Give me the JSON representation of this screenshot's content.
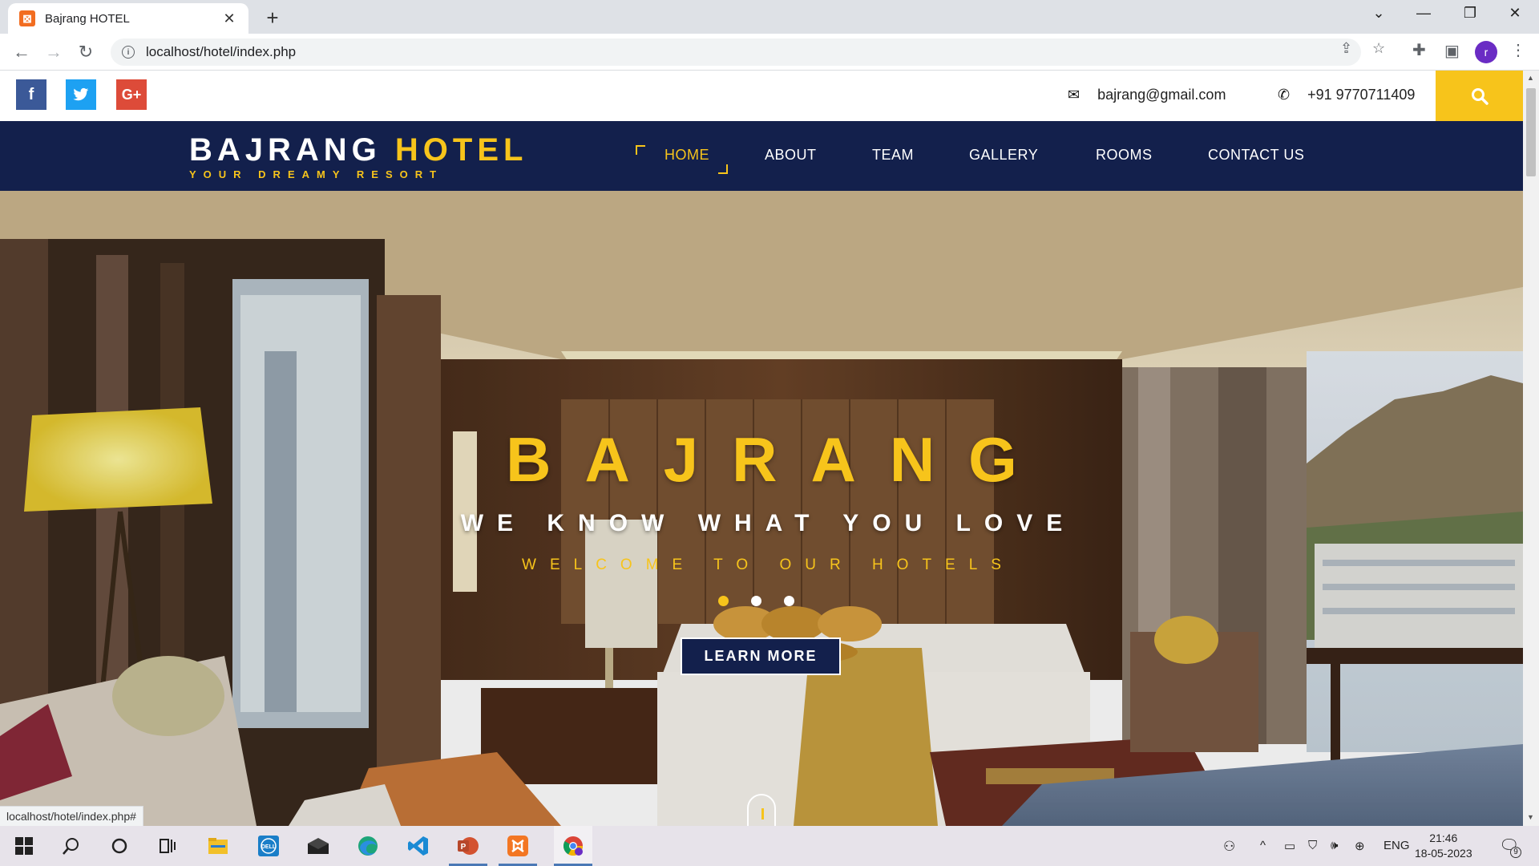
{
  "browser": {
    "tab_title": "Bajrang HOTEL",
    "tab_favicon": "xampp-icon",
    "url": "localhost/hotel/index.php",
    "profile_initial": "r",
    "new_tab_glyph": "+",
    "close_glyph": "✕",
    "back_glyph": "←",
    "forward_glyph": "→",
    "reload_glyph": "↻"
  },
  "topbar": {
    "social": [
      {
        "name": "facebook",
        "glyph": "f",
        "color": "#3b5998"
      },
      {
        "name": "twitter",
        "glyph": "t",
        "color": "#1da1f2"
      },
      {
        "name": "google-plus",
        "glyph": "G+",
        "color": "#dd4b39"
      }
    ],
    "email": "bajrang@gmail.com",
    "phone": "+91 9770711409",
    "search_color": "#f7c41b"
  },
  "navbar": {
    "brand_part1": "BAJRANG",
    "brand_part2": "HOTEL",
    "tagline": "YOUR DREAMY RESORT",
    "menu": [
      {
        "label": "HOME",
        "active": true
      },
      {
        "label": "ABOUT",
        "active": false
      },
      {
        "label": "TEAM",
        "active": false
      },
      {
        "label": "GALLERY",
        "active": false
      },
      {
        "label": "ROOMS",
        "active": false
      },
      {
        "label": "CONTACT US",
        "active": false
      }
    ],
    "bg_color": "#13204c",
    "accent_color": "#f7c41b"
  },
  "hero": {
    "title": "BAJRANG",
    "subtitle": "WE KNOW WHAT YOU LOVE",
    "tagline": "WELCOME TO OUR HOTELS",
    "cta": "LEARN MORE",
    "slides": 3,
    "active_slide": 1
  },
  "status_bar": {
    "hover_url": "localhost/hotel/index.php#"
  },
  "taskbar": {
    "language": "ENG",
    "time": "21:46",
    "date": "18-05-2023",
    "notification_count": "9",
    "apps": [
      "start-icon",
      "search-icon",
      "cortana-icon",
      "task-view-icon",
      "file-explorer-icon",
      "dell-icon",
      "mail-icon",
      "edge-icon",
      "vscode-icon",
      "powerpoint-icon",
      "xampp-icon",
      "chrome-icon"
    ]
  }
}
